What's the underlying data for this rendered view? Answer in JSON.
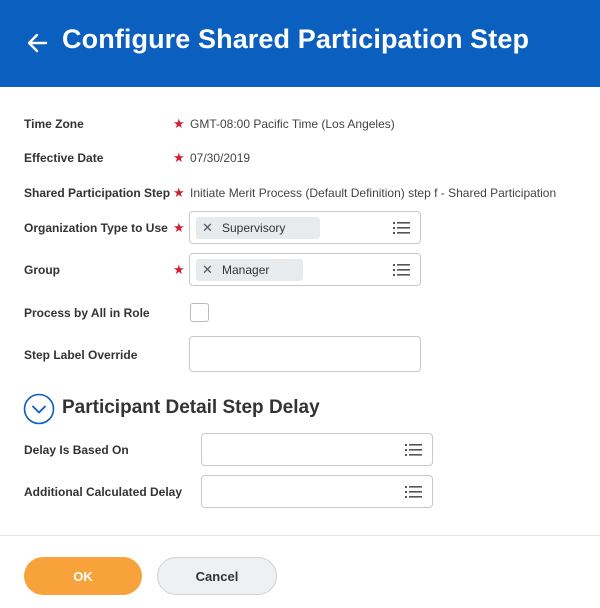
{
  "header": {
    "title": "Configure Shared Participation Step",
    "background": "#0b5fbe"
  },
  "form": {
    "time_zone": {
      "label": "Time Zone",
      "value": "GMT-08:00 Pacific Time (Los Angeles)"
    },
    "effective_date": {
      "label": "Effective Date",
      "value": "07/30/2019"
    },
    "shared_participation_step": {
      "label": "Shared Participation Step",
      "value": "Initiate Merit Process (Default Definition) step f - Shared Participation"
    },
    "organization_type": {
      "label": "Organization Type to Use",
      "selected": "Supervisory"
    },
    "group": {
      "label": "Group",
      "selected": "Manager"
    },
    "process_by_all": {
      "label": "Process by All in Role",
      "checked": false
    },
    "step_label_override": {
      "label": "Step Label Override",
      "value": ""
    },
    "required_marker": "★"
  },
  "section": {
    "title": "Participant Detail Step Delay",
    "delay_based_on": {
      "label": "Delay Is Based On"
    },
    "additional_delay": {
      "label": "Additional Calculated Delay"
    }
  },
  "footer": {
    "ok_label": "OK",
    "cancel_label": "Cancel",
    "ok_color": "#f7a23a"
  },
  "icons": {
    "back": "back-arrow-icon",
    "clear": "close-icon",
    "list": "list-icon",
    "collapse": "chevron-down-icon"
  }
}
